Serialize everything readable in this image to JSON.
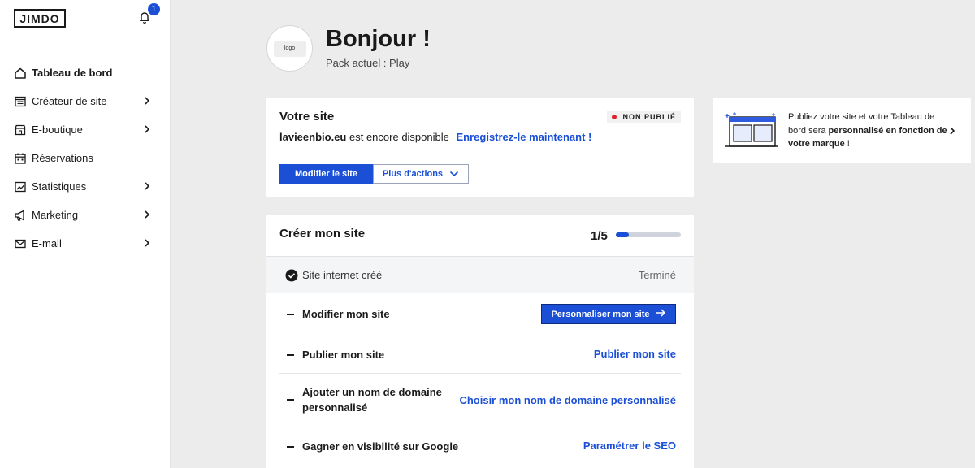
{
  "brand": {
    "logo_text": "JIMDO"
  },
  "notifications": {
    "count": "1"
  },
  "sidebar": {
    "items": [
      {
        "label": "Tableau de bord",
        "icon": "home-icon",
        "active": true,
        "has_chevron": false
      },
      {
        "label": "Créateur de site",
        "icon": "layout-icon",
        "has_chevron": true
      },
      {
        "label": "E-boutique",
        "icon": "store-icon",
        "has_chevron": true
      },
      {
        "label": "Réservations",
        "icon": "calendar-icon",
        "has_chevron": false
      },
      {
        "label": "Statistiques",
        "icon": "chart-icon",
        "has_chevron": true
      },
      {
        "label": "Marketing",
        "icon": "megaphone-icon",
        "has_chevron": true
      },
      {
        "label": "E-mail",
        "icon": "mail-icon",
        "has_chevron": true
      }
    ]
  },
  "header": {
    "avatar_text": "logo",
    "greeting": "Bonjour !",
    "plan": "Pack actuel : Play"
  },
  "site_card": {
    "title": "Votre site",
    "status": "NON PUBLIÉ",
    "domain": "lavieenbio.eu",
    "domain_suffix": "est encore disponible",
    "register_link": "Enregistrez-le maintenant !",
    "edit_button": "Modifier le site",
    "more_button": "Plus d'actions"
  },
  "promo_card": {
    "text_start": "Publiez votre site et votre Tableau de bord sera",
    "text_bold": "personnalisé en fonction de votre marque",
    "text_end": "!"
  },
  "checklist": {
    "title": "Créer mon site",
    "progress_label": "1/5",
    "progress": 0.2,
    "done": {
      "label": "Site internet créé",
      "state": "Terminé"
    },
    "tasks": [
      {
        "label": "Modifier mon site",
        "action": "Personnaliser mon site",
        "action_type": "button"
      },
      {
        "label": "Publier mon site",
        "action": "Publier mon site",
        "action_type": "link"
      },
      {
        "label": "Ajouter un nom de domaine personnalisé",
        "action": "Choisir mon nom de domaine personnalisé",
        "action_type": "link"
      },
      {
        "label": "Gagner en visibilité sur Google",
        "action": "Paramétrer le SEO",
        "action_type": "link"
      }
    ]
  },
  "colors": {
    "accent": "#1a4fd6",
    "status_dot": "#e0242b",
    "background": "#ececec"
  }
}
